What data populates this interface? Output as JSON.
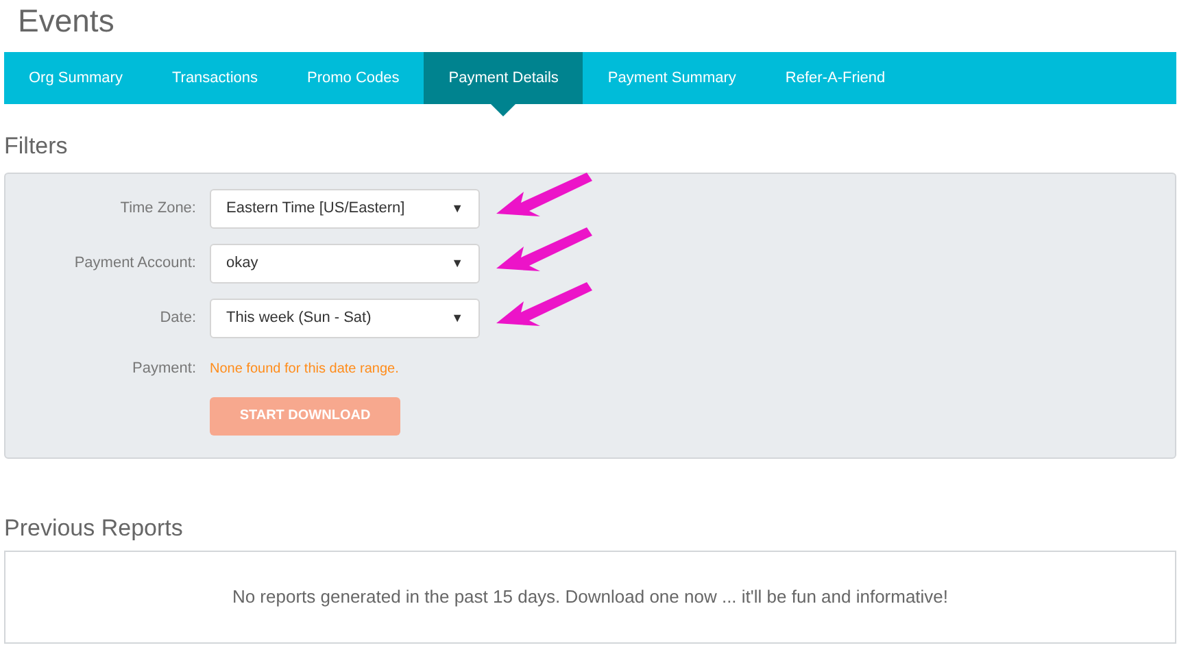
{
  "page_title": "Events",
  "tabs": [
    {
      "label": "Org Summary",
      "selected": false
    },
    {
      "label": "Transactions",
      "selected": false
    },
    {
      "label": "Promo Codes",
      "selected": false
    },
    {
      "label": "Payment Details",
      "selected": true
    },
    {
      "label": "Payment Summary",
      "selected": false
    },
    {
      "label": "Refer-A-Friend",
      "selected": false
    }
  ],
  "filters": {
    "heading": "Filters",
    "fields": [
      {
        "label": "Time Zone:",
        "value": "Eastern Time [US/Eastern]",
        "caret": "▼",
        "annotated": true
      },
      {
        "label": "Payment Account:",
        "value": "okay",
        "caret": "▼",
        "annotated": true
      },
      {
        "label": "Date:",
        "value": "This week (Sun - Sat)",
        "caret": "▼",
        "annotated": true
      }
    ],
    "payment": {
      "label": "Payment:",
      "message": "None found for this date range."
    },
    "download_button": {
      "label": "START DOWNLOAD",
      "disabled": true
    }
  },
  "previous_reports": {
    "heading": "Previous Reports",
    "message": "No reports generated in the past 15 days. Download one now ... it'll be fun and informative!"
  }
}
